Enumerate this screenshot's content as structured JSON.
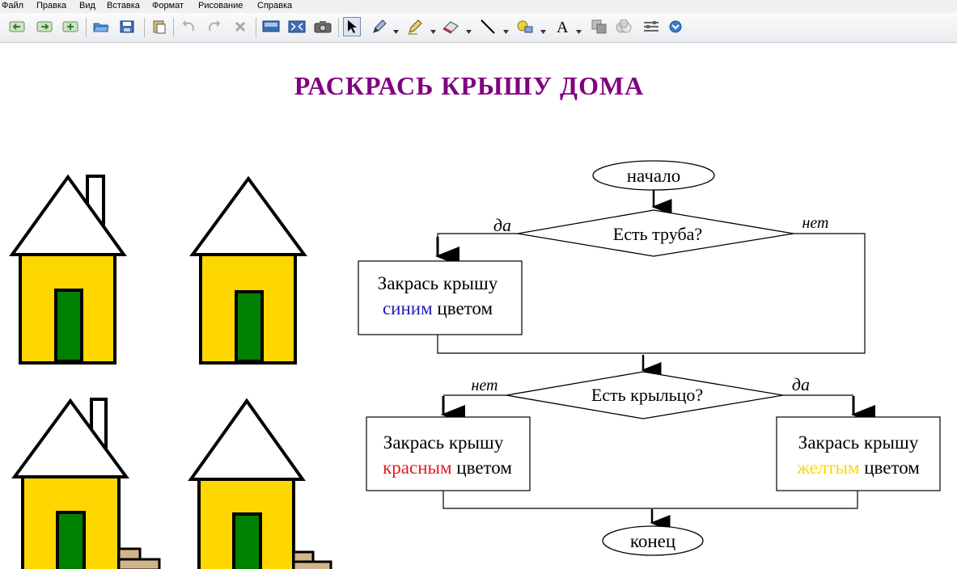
{
  "menu": [
    "Файл",
    "Правка",
    "Вид",
    "Вставка",
    "Формат",
    "Рисование",
    "Справка"
  ],
  "toolbar": {
    "icons": [
      "back-page-icon",
      "forward-page-icon",
      "add-page-icon",
      "open-icon",
      "save-icon",
      "paste-icon",
      "undo-icon",
      "redo-icon",
      "delete-icon",
      "screen-shade-icon",
      "full-screen-icon",
      "capture-icon",
      "select-icon",
      "pen-icon",
      "highlighter-icon",
      "eraser-icon",
      "line-icon",
      "fill-icon",
      "text-icon",
      "shapes-icon",
      "transparency-icon",
      "properties-icon",
      "more-icon"
    ]
  },
  "slide": {
    "title": "РАСКРАСЬ КРЫШУ ДОМА",
    "flowchart": {
      "start": "начало",
      "decision1": "Есть труба?",
      "decision1_yes": "да",
      "decision1_no": "нет",
      "box_blue": {
        "line1": "Закрась крышу",
        "color_word": "синим",
        "rest": " цветом"
      },
      "decision2": "Есть крыльцо?",
      "decision2_no": "нет",
      "decision2_yes": "да",
      "box_red": {
        "line1": "Закрась крышу",
        "color_word": "красным",
        "rest": " цветом"
      },
      "box_yellow": {
        "line1": "Закрась крышу",
        "color_word": "желтым",
        "rest": " цветом"
      },
      "end": "конец"
    },
    "colors": {
      "title": "#800080",
      "house_wall": "#ffd700",
      "house_door": "#008000",
      "roof": "#ffffff",
      "steps": "#d2b48c",
      "blue_word": "#1f1fb4",
      "red_word": "#e31c1c",
      "yellow_word": "#ffd700"
    }
  }
}
